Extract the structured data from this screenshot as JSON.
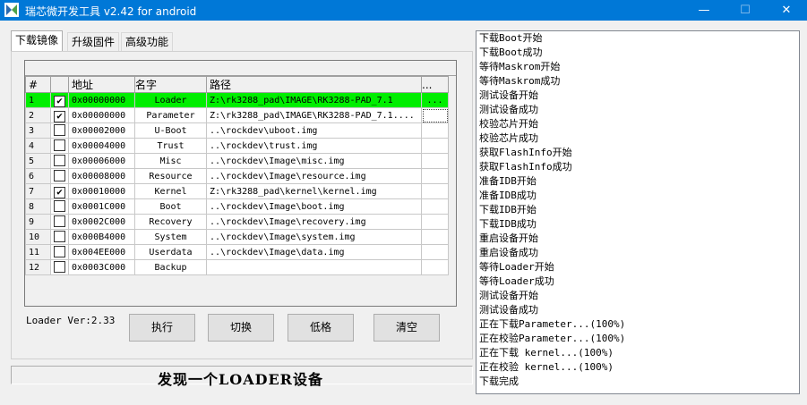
{
  "window": {
    "title": "瑞芯微开发工具 v2.42 for android",
    "icon": "app-icon",
    "min": "—",
    "max": "☐",
    "close": "✕"
  },
  "tabs": [
    {
      "label": "下载镜像",
      "active": true
    },
    {
      "label": "升级固件",
      "active": false
    },
    {
      "label": "高级功能",
      "active": false
    }
  ],
  "table": {
    "headers": [
      "#",
      "",
      "地址",
      "名字",
      "路径",
      "..."
    ],
    "rows": [
      {
        "num": "1",
        "checked": true,
        "addr": "0x00000000",
        "name": "Loader",
        "path": "Z:\\rk3288_pad\\IMAGE\\RK3288-PAD_7.1",
        "dots": "...",
        "selected": true
      },
      {
        "num": "2",
        "checked": true,
        "addr": "0x00000000",
        "name": "Parameter",
        "path": "Z:\\rk3288_pad\\IMAGE\\RK3288-PAD_7.1....",
        "dots": "",
        "selected": false
      },
      {
        "num": "3",
        "checked": false,
        "addr": "0x00002000",
        "name": "U-Boot",
        "path": "..\\rockdev\\uboot.img",
        "dots": "",
        "selected": false
      },
      {
        "num": "4",
        "checked": false,
        "addr": "0x00004000",
        "name": "Trust",
        "path": "..\\rockdev\\trust.img",
        "dots": "",
        "selected": false
      },
      {
        "num": "5",
        "checked": false,
        "addr": "0x00006000",
        "name": "Misc",
        "path": "..\\rockdev\\Image\\misc.img",
        "dots": "",
        "selected": false
      },
      {
        "num": "6",
        "checked": false,
        "addr": "0x00008000",
        "name": "Resource",
        "path": "..\\rockdev\\Image\\resource.img",
        "dots": "",
        "selected": false
      },
      {
        "num": "7",
        "checked": true,
        "addr": "0x00010000",
        "name": "Kernel",
        "path": "Z:\\rk3288_pad\\kernel\\kernel.img",
        "dots": "",
        "selected": false
      },
      {
        "num": "8",
        "checked": false,
        "addr": "0x0001C000",
        "name": "Boot",
        "path": "..\\rockdev\\Image\\boot.img",
        "dots": "",
        "selected": false
      },
      {
        "num": "9",
        "checked": false,
        "addr": "0x0002C000",
        "name": "Recovery",
        "path": "..\\rockdev\\Image\\recovery.img",
        "dots": "",
        "selected": false
      },
      {
        "num": "10",
        "checked": false,
        "addr": "0x000B4000",
        "name": "System",
        "path": "..\\rockdev\\Image\\system.img",
        "dots": "",
        "selected": false
      },
      {
        "num": "11",
        "checked": false,
        "addr": "0x004EE000",
        "name": "Userdata",
        "path": "..\\rockdev\\Image\\data.img",
        "dots": "",
        "selected": false
      },
      {
        "num": "12",
        "checked": false,
        "addr": "0x0003C000",
        "name": "Backup",
        "path": "",
        "dots": "",
        "selected": false
      }
    ]
  },
  "loader_version": "Loader Ver:2.33",
  "buttons": {
    "execute": "执行",
    "switch": "切换",
    "low_format": "低格",
    "clear": "清空"
  },
  "status": "发现一个LOADER设备",
  "log": [
    "下载Boot开始",
    "下载Boot成功",
    "等待Maskrom开始",
    "等待Maskrom成功",
    "测试设备开始",
    "测试设备成功",
    "校验芯片开始",
    "校验芯片成功",
    "获取FlashInfo开始",
    "获取FlashInfo成功",
    "准备IDB开始",
    "准备IDB成功",
    "下载IDB开始",
    "下载IDB成功",
    "重启设备开始",
    "重启设备成功",
    "等待Loader开始",
    "等待Loader成功",
    "测试设备开始",
    "测试设备成功",
    "正在下载Parameter...(100%)",
    "正在校验Parameter...(100%)",
    "正在下载 kernel...(100%)",
    "正在校验 kernel...(100%)",
    "下载完成"
  ]
}
